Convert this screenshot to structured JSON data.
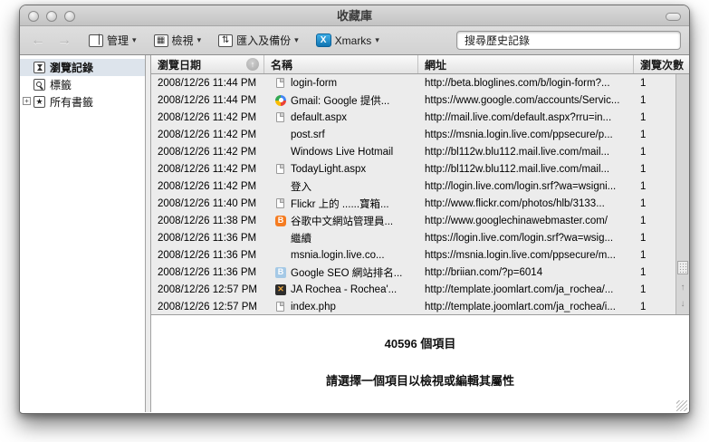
{
  "window": {
    "title": "收藏庫"
  },
  "toolbar": {
    "organize_label": "管理",
    "views_label": "檢視",
    "import_backup_label": "匯入及備份",
    "xmarks_label": "Xmarks",
    "search_placeholder": "搜尋歷史記錄"
  },
  "sidebar": {
    "items": [
      {
        "label": "瀏覽記錄",
        "icon": "history-icon",
        "selected": true
      },
      {
        "label": "標籤",
        "icon": "tags-icon",
        "selected": false
      },
      {
        "label": "所有書籤",
        "icon": "bookmarks-icon",
        "selected": false,
        "expandable": true
      }
    ]
  },
  "table": {
    "columns": [
      {
        "label": "瀏覽日期",
        "sorted": "ascending"
      },
      {
        "label": "名稱"
      },
      {
        "label": "網址"
      },
      {
        "label": "瀏覽次數"
      }
    ],
    "rows": [
      {
        "date": "2008/12/26 11:44 PM",
        "icon": "page",
        "name": "login-form",
        "url": "http://beta.bloglines.com/b/login-form?...",
        "count": "1"
      },
      {
        "date": "2008/12/26 11:44 PM",
        "icon": "google",
        "name": "Gmail: Google 提供...",
        "url": "https://www.google.com/accounts/Servic...",
        "count": "1"
      },
      {
        "date": "2008/12/26 11:42 PM",
        "icon": "page",
        "name": "default.aspx",
        "url": "http://mail.live.com/default.aspx?rru=in...",
        "count": "1"
      },
      {
        "date": "2008/12/26 11:42 PM",
        "icon": "windows",
        "name": "post.srf",
        "url": "https://msnia.login.live.com/ppsecure/p...",
        "count": "1"
      },
      {
        "date": "2008/12/26 11:42 PM",
        "icon": "windows",
        "name": "Windows Live Hotmail",
        "url": "http://bl112w.blu112.mail.live.com/mail...",
        "count": "1"
      },
      {
        "date": "2008/12/26 11:42 PM",
        "icon": "page",
        "name": "TodayLight.aspx",
        "url": "http://bl112w.blu112.mail.live.com/mail...",
        "count": "1"
      },
      {
        "date": "2008/12/26 11:42 PM",
        "icon": "windows",
        "name": "登入",
        "url": "http://login.live.com/login.srf?wa=wsigni...",
        "count": "1"
      },
      {
        "date": "2008/12/26 11:40 PM",
        "icon": "page",
        "name": "Flickr 上的 ......寶箱...",
        "url": "http://www.flickr.com/photos/hlb/3133...",
        "count": "1"
      },
      {
        "date": "2008/12/26 11:38 PM",
        "icon": "blogger",
        "name": "谷歌中文網站管理員...",
        "url": "http://www.googlechinawebmaster.com/",
        "count": "1"
      },
      {
        "date": "2008/12/26 11:36 PM",
        "icon": "windows",
        "name": "繼續",
        "url": "https://login.live.com/login.srf?wa=wsig...",
        "count": "1"
      },
      {
        "date": "2008/12/26 11:36 PM",
        "icon": "windows",
        "name": "msnia.login.live.co...",
        "url": "https://msnia.login.live.com/ppsecure/m...",
        "count": "1"
      },
      {
        "date": "2008/12/26 11:36 PM",
        "icon": "blue-b",
        "name": "Google SEO 網站排名...",
        "url": "http://briian.com/?p=6014",
        "count": "1"
      },
      {
        "date": "2008/12/26 12:57 PM",
        "icon": "joomla",
        "name": "JA Rochea - Rochea'...",
        "url": "http://template.joomlart.com/ja_rochea/...",
        "count": "1"
      },
      {
        "date": "2008/12/26 12:57 PM",
        "icon": "page",
        "name": "index.php",
        "url": "http://template.joomlart.com/ja_rochea/i...",
        "count": "1"
      }
    ]
  },
  "status": {
    "item_count": "40596 個項目",
    "hint": "請選擇一個項目以檢視或編輯其屬性"
  }
}
